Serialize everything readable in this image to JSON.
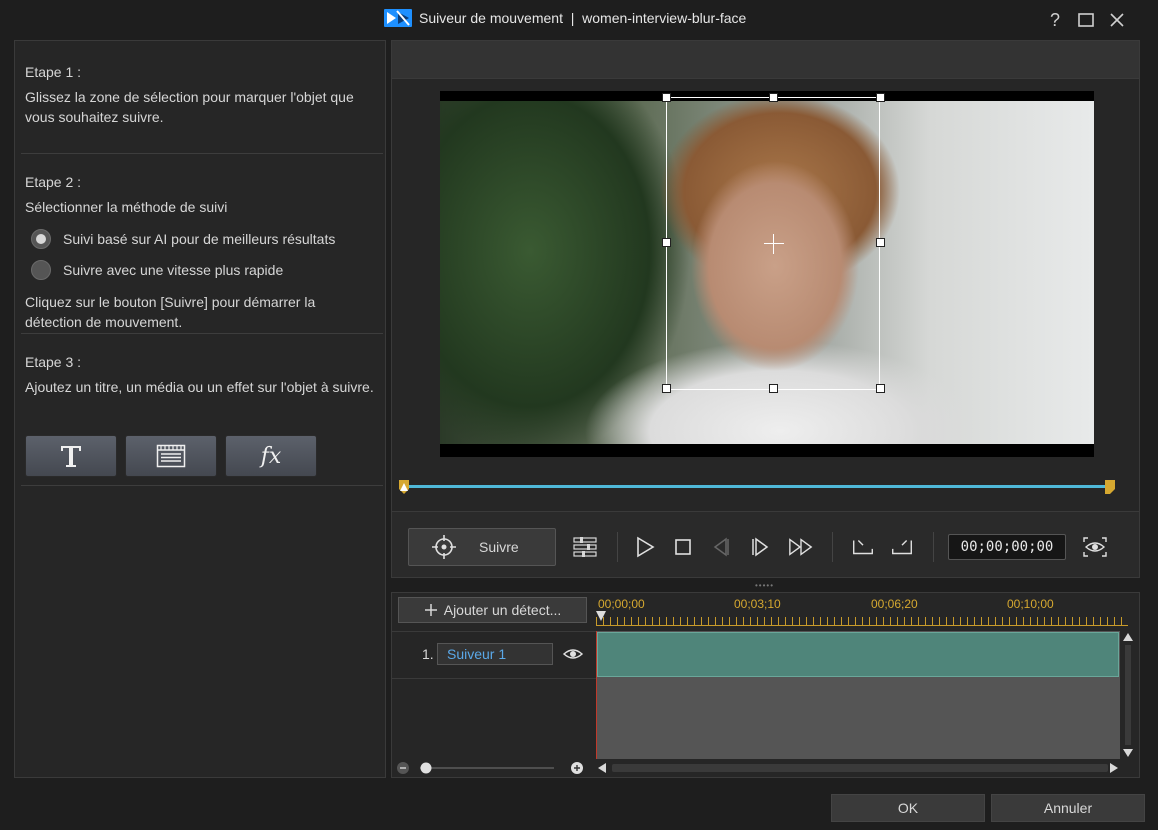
{
  "window": {
    "title": "Suiveur de mouvement  |  women-interview-blur-face",
    "help_label": "?",
    "accent": "#1e90ff"
  },
  "left": {
    "step1_heading": "Etape 1 :",
    "step1_text": "Glissez la zone de sélection pour marquer l'objet que vous souhaitez suivre.",
    "step2_heading": "Etape 2 :",
    "step2_text": "Sélectionner la méthode de suivi",
    "radio_ai": "Suivi basé sur AI pour de meilleurs résultats",
    "radio_fast": "Suivre avec une vitesse plus rapide",
    "selected_method": "ai",
    "step2_hint": "Cliquez sur le bouton [Suivre] pour démarrer la détection de mouvement.",
    "step3_heading": "Etape 3 :",
    "step3_text": "Ajoutez un titre, un média ou un effet sur l'objet à suivre.",
    "tools": {
      "title_icon": "title-T-icon",
      "media_icon": "media-clapper-icon",
      "effect_label": "fx"
    }
  },
  "player": {
    "track_button": "Suivre",
    "timecode": "00;00;00;00",
    "icons": [
      "crosshair-icon",
      "track-options-icon",
      "play-icon",
      "stop-icon",
      "prev-frame-icon",
      "next-frame-icon",
      "fast-forward-icon",
      "mark-in-icon",
      "mark-out-icon",
      "preview-eye-icon"
    ]
  },
  "timeline": {
    "add_button": "Ajouter un détect...",
    "ruler": [
      "00;00;00",
      "00;03;10",
      "00;06;20",
      "00;10;00"
    ],
    "tracks": [
      {
        "number": "1.",
        "name": "Suiveur 1"
      }
    ]
  },
  "footer": {
    "ok": "OK",
    "cancel": "Annuler"
  },
  "colors": {
    "timeline_ruler": "#d6a830",
    "track_clip": "#4f857a",
    "slider": "#4fb8d8",
    "track_name": "#5aa8e8"
  }
}
